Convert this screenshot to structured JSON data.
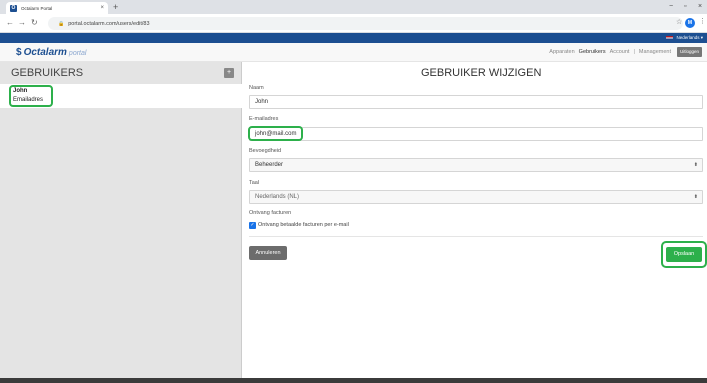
{
  "browser": {
    "tab_title": "Octalarm Portal",
    "tab_favicon_letter": "O",
    "url": "portal.octalarm.com/users/edit/83",
    "profile_initial": "M"
  },
  "language": {
    "label": "Nederlands ▾"
  },
  "header": {
    "logo_text": "Octalarm",
    "logo_sub": "portal",
    "nav": [
      {
        "label": "Apparaten",
        "active": false
      },
      {
        "label": "Gebruikers",
        "active": true
      },
      {
        "label": "Account",
        "active": false
      },
      {
        "label": "Management",
        "active": false
      }
    ],
    "logout_label": "Uitloggen"
  },
  "sidebar": {
    "title": "GEBRUIKERS",
    "add_label": "+",
    "users": [
      {
        "name": "John",
        "email": "Emailadres"
      }
    ]
  },
  "form": {
    "title": "GEBRUIKER WIJZIGEN",
    "name_label": "Naam",
    "name_value": "John",
    "email_label": "E-mailadres",
    "email_value": "john@mail.com",
    "permission_label": "Bevoegdheid",
    "permission_value": "Beheerder",
    "language_label": "Taal",
    "language_value": "Nederlands (NL)",
    "invoices_label": "Ontvang facturen",
    "invoices_checkbox_label": "Ontvang betaalde facturen per e-mail",
    "invoices_checked": true,
    "cancel_label": "Annuleren",
    "save_label": "Opslaan"
  },
  "colors": {
    "brand": "#1d4f91",
    "highlight": "#2db04b",
    "sidebar_bg": "#e4e4e4"
  }
}
